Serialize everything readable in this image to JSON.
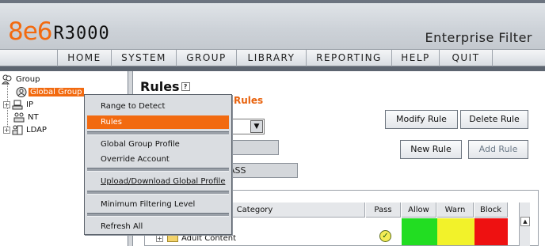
{
  "app": {
    "logo_brand": "8e6",
    "logo_model": "R3000",
    "product_name": "Enterprise Filter"
  },
  "nav": {
    "items": [
      "HOME",
      "SYSTEM",
      "GROUP",
      "LIBRARY",
      "REPORTING",
      "HELP",
      "QUIT"
    ]
  },
  "tree": {
    "root_label": "Group",
    "items": [
      {
        "label": "Global Group",
        "selected": true
      },
      {
        "label": "IP"
      },
      {
        "label": "NT"
      },
      {
        "label": "LDAP"
      }
    ]
  },
  "main": {
    "title": "Rules",
    "help_icon": "?",
    "subtitle_visible": "-Rules",
    "field_2_visible": "ASS",
    "buttons": {
      "modify": "Modify Rule",
      "delete": "Delete Rule",
      "new": "New Rule",
      "add": "Add Rule"
    },
    "table": {
      "headers": [
        "Category",
        "Pass",
        "Allow",
        "Warn",
        "Block"
      ],
      "rows": [
        {
          "category": "Adult Content",
          "pass": true
        }
      ],
      "colors": {
        "allow": "#22dd22",
        "warn": "#f2f22a",
        "block": "#ee1111"
      }
    }
  },
  "context_menu": {
    "items": [
      {
        "label": "Range to Detect"
      },
      {
        "label": "Rules",
        "selected": true
      },
      {
        "label": "Global Group Profile"
      },
      {
        "label": "Override Account"
      },
      {
        "label": "Upload/Download Global Profile"
      },
      {
        "label": "Minimum Filtering Level"
      },
      {
        "label": "Refresh All"
      }
    ]
  },
  "colors": {
    "accent": "#f26a10",
    "nav_bg": "#e6e8eb",
    "panel_bg": "#dadde1"
  }
}
